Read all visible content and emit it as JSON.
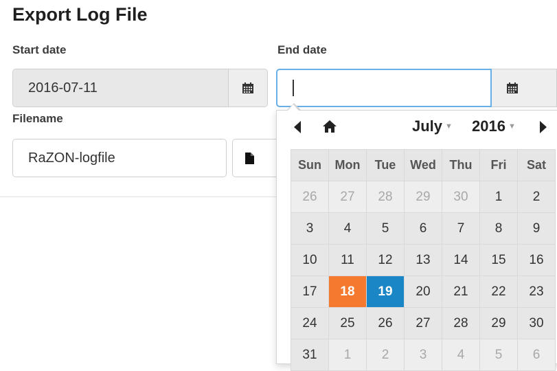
{
  "title": "Export Log File",
  "start_date": {
    "label": "Start date",
    "value": "2016-07-11"
  },
  "end_date": {
    "label": "End date",
    "value": ""
  },
  "filename": {
    "label": "Filename",
    "value": "RaZON-logfile"
  },
  "icons": {
    "calendar": "calendar-icon",
    "file": "file-icon",
    "prev": "arrow-left-icon",
    "home": "home-icon",
    "next": "arrow-right-icon"
  },
  "colors": {
    "today": "#f57a2f",
    "selected": "#1b86c6"
  },
  "calendar": {
    "month": "July",
    "year": "2016",
    "weekdays": [
      "Sun",
      "Mon",
      "Tue",
      "Wed",
      "Thu",
      "Fri",
      "Sat"
    ],
    "weeks": [
      [
        {
          "d": "26",
          "t": "old"
        },
        {
          "d": "27",
          "t": "old"
        },
        {
          "d": "28",
          "t": "old"
        },
        {
          "d": "29",
          "t": "old"
        },
        {
          "d": "30",
          "t": "old"
        },
        {
          "d": "1",
          "t": ""
        },
        {
          "d": "2",
          "t": ""
        }
      ],
      [
        {
          "d": "3",
          "t": ""
        },
        {
          "d": "4",
          "t": ""
        },
        {
          "d": "5",
          "t": ""
        },
        {
          "d": "6",
          "t": ""
        },
        {
          "d": "7",
          "t": ""
        },
        {
          "d": "8",
          "t": ""
        },
        {
          "d": "9",
          "t": ""
        }
      ],
      [
        {
          "d": "10",
          "t": ""
        },
        {
          "d": "11",
          "t": ""
        },
        {
          "d": "12",
          "t": ""
        },
        {
          "d": "13",
          "t": ""
        },
        {
          "d": "14",
          "t": ""
        },
        {
          "d": "15",
          "t": ""
        },
        {
          "d": "16",
          "t": ""
        }
      ],
      [
        {
          "d": "17",
          "t": ""
        },
        {
          "d": "18",
          "t": "today"
        },
        {
          "d": "19",
          "t": "active"
        },
        {
          "d": "20",
          "t": ""
        },
        {
          "d": "21",
          "t": ""
        },
        {
          "d": "22",
          "t": ""
        },
        {
          "d": "23",
          "t": ""
        }
      ],
      [
        {
          "d": "24",
          "t": ""
        },
        {
          "d": "25",
          "t": ""
        },
        {
          "d": "26",
          "t": ""
        },
        {
          "d": "27",
          "t": ""
        },
        {
          "d": "28",
          "t": ""
        },
        {
          "d": "29",
          "t": ""
        },
        {
          "d": "30",
          "t": ""
        }
      ],
      [
        {
          "d": "31",
          "t": ""
        },
        {
          "d": "1",
          "t": "old"
        },
        {
          "d": "2",
          "t": "old"
        },
        {
          "d": "3",
          "t": "old"
        },
        {
          "d": "4",
          "t": "old"
        },
        {
          "d": "5",
          "t": "old"
        },
        {
          "d": "6",
          "t": "old"
        }
      ]
    ]
  }
}
